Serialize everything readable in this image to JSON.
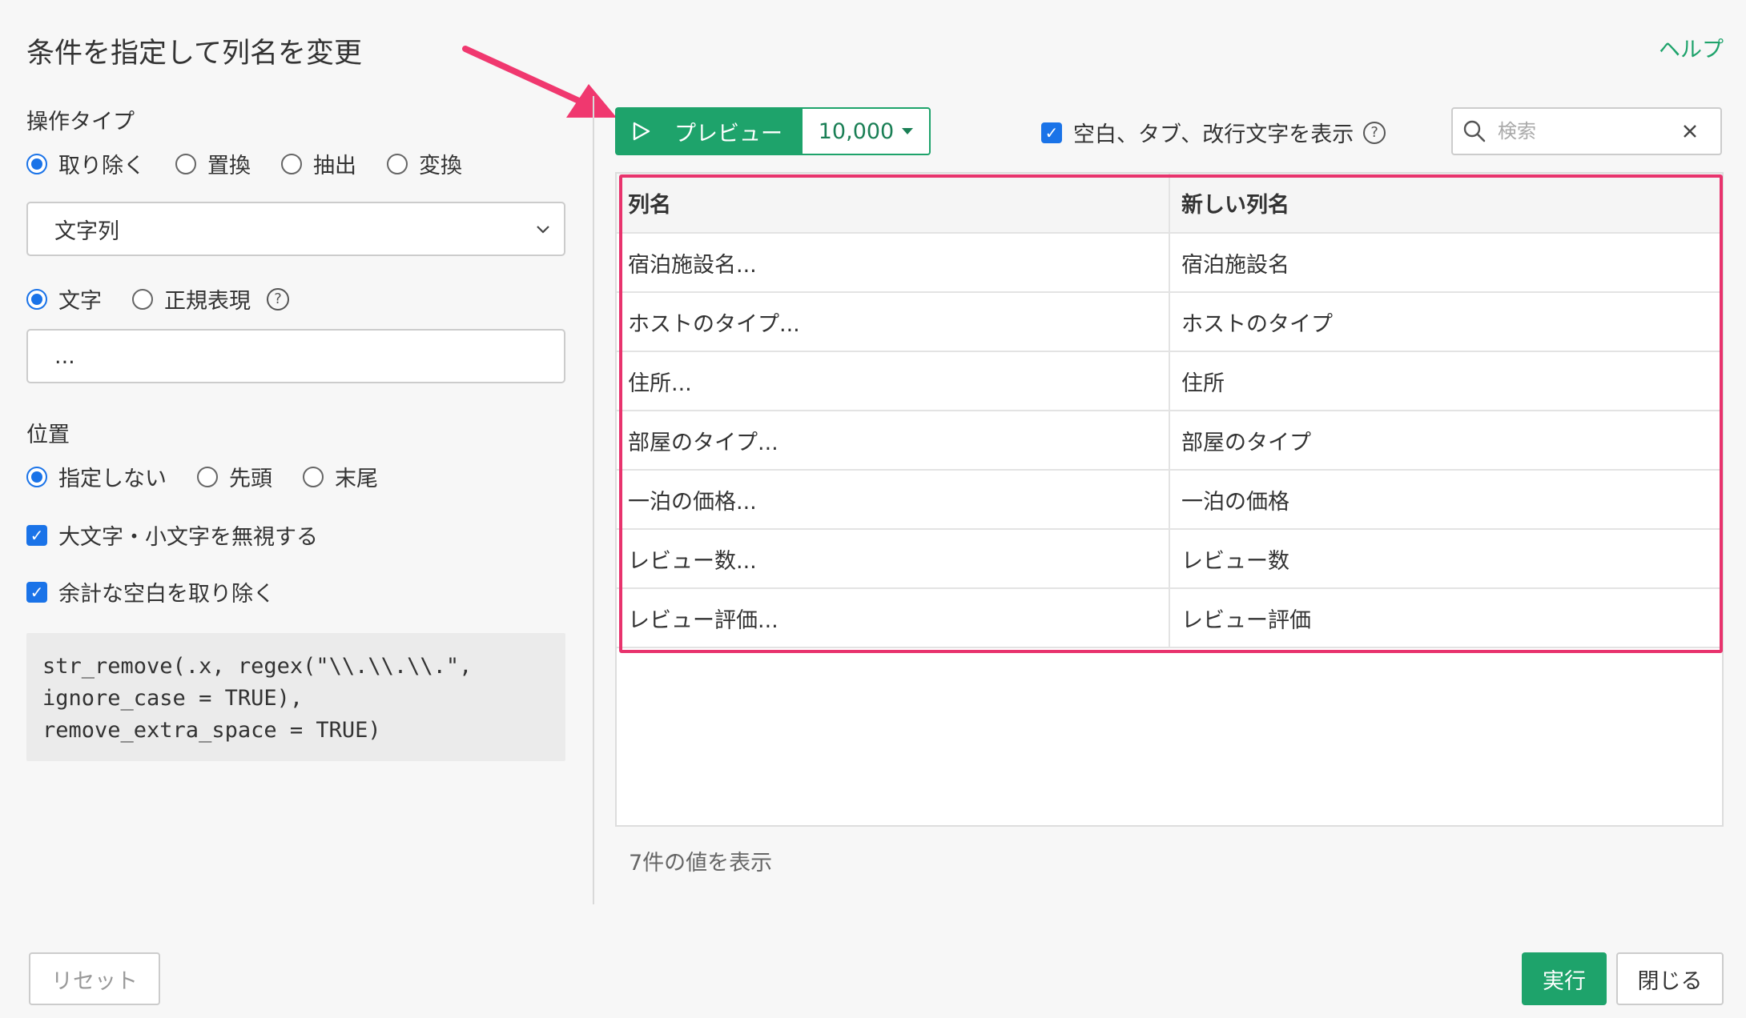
{
  "dialog": {
    "title": "条件を指定して列名を変更",
    "help_label": "ヘルプ"
  },
  "operation": {
    "label": "操作タイプ",
    "options": [
      "取り除く",
      "置換",
      "抽出",
      "変換"
    ],
    "selected": "取り除く"
  },
  "target_select": {
    "value": "文字列"
  },
  "match_type": {
    "options": [
      "文字",
      "正規表現"
    ],
    "selected": "文字",
    "help_icon": "question-icon"
  },
  "pattern_input": {
    "value": "..."
  },
  "position": {
    "label": "位置",
    "options": [
      "指定しない",
      "先頭",
      "末尾"
    ],
    "selected": "指定しない"
  },
  "options": {
    "ignore_case": {
      "label": "大文字・小文字を無視する",
      "checked": true
    },
    "remove_extra_space": {
      "label": "余計な空白を取り除く",
      "checked": true
    }
  },
  "code": {
    "text": "str_remove(.x, regex(\"\\\\.\\\\.\\\\.\",\nignore_case = TRUE),\nremove_extra_space = TRUE)"
  },
  "preview": {
    "button_label": "プレビュー",
    "rows_label": "10,000",
    "show_whitespace_label": "空白、タブ、改行文字を表示",
    "show_whitespace_checked": true,
    "search_placeholder": "検索"
  },
  "table": {
    "headers": [
      "列名",
      "新しい列名"
    ],
    "rows": [
      [
        "宿泊施設名...",
        "宿泊施設名"
      ],
      [
        "ホストのタイプ...",
        "ホストのタイプ"
      ],
      [
        "住所...",
        "住所"
      ],
      [
        "部屋のタイプ...",
        "部屋のタイプ"
      ],
      [
        "一泊の価格...",
        "一泊の価格"
      ],
      [
        "レビュー数...",
        "レビュー数"
      ],
      [
        "レビュー評価...",
        "レビュー評価"
      ]
    ]
  },
  "footer": {
    "count_text": "7件の値を表示",
    "reset_label": "リセット",
    "run_label": "実行",
    "close_label": "閉じる"
  },
  "colors": {
    "accent_green": "#1ea36b",
    "radio_blue": "#1a73e8",
    "highlight_pink": "#e8336d"
  }
}
